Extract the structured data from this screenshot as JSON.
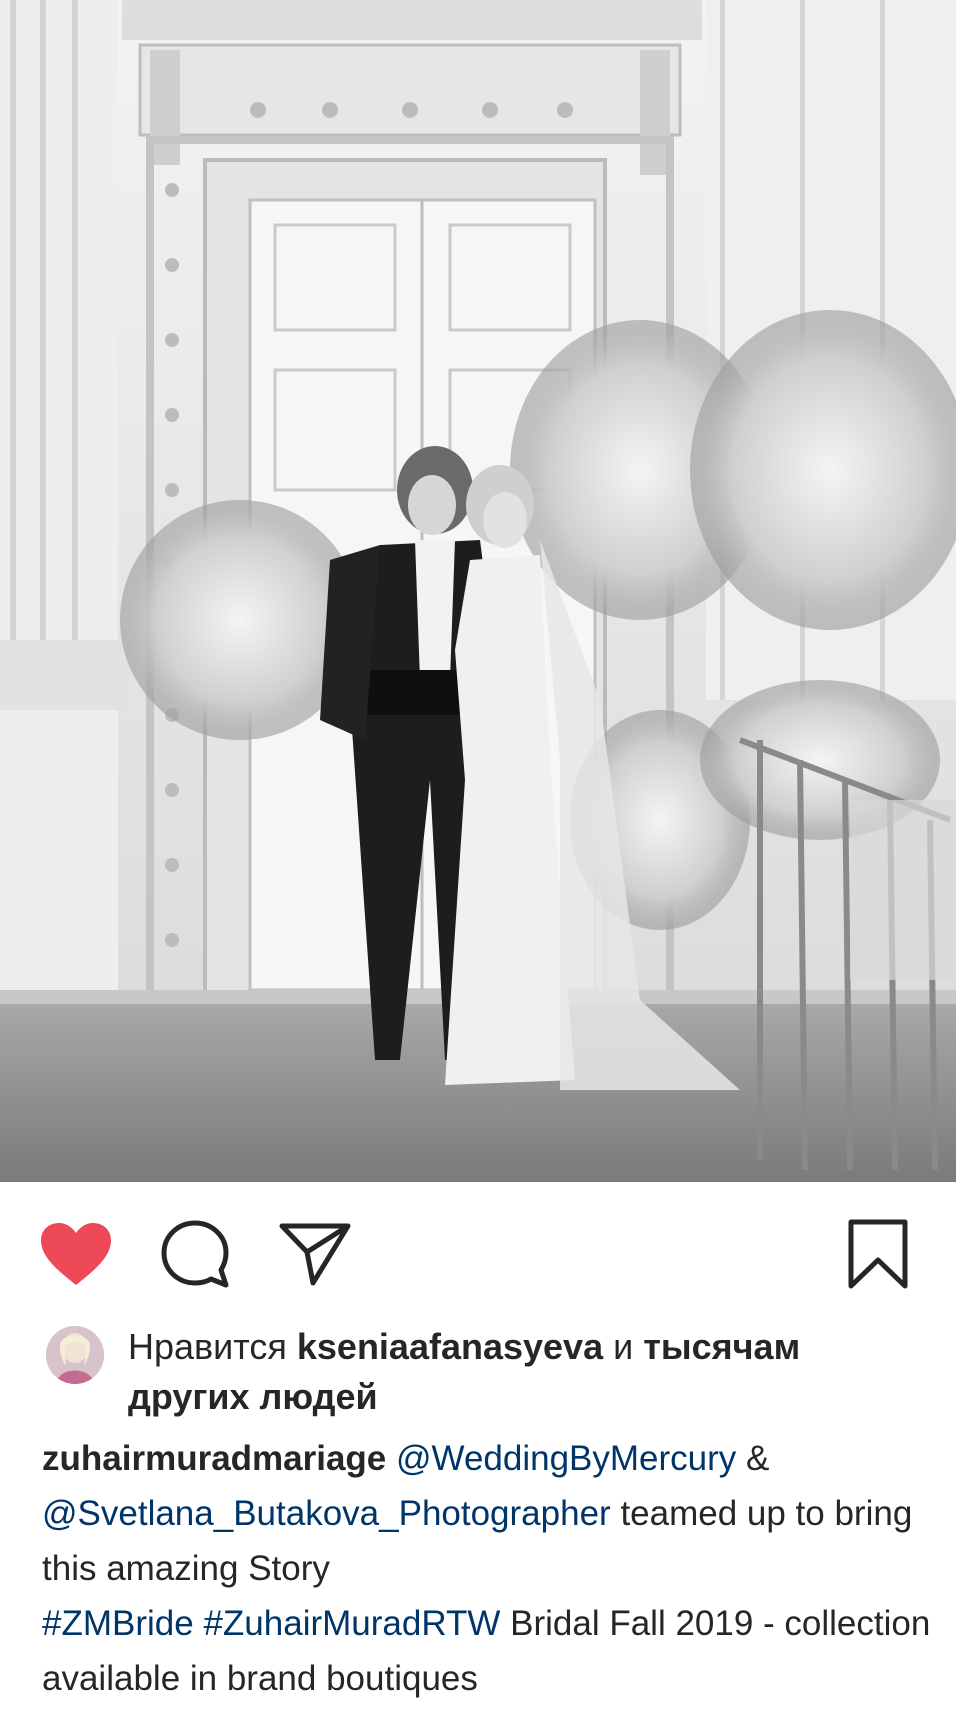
{
  "post": {
    "photo_alt": "black and white wedding photo",
    "liked": true
  },
  "actions": {
    "like_icon": "heart-filled-icon",
    "comment_icon": "comment-icon",
    "share_icon": "paper-plane-icon",
    "save_icon": "bookmark-icon",
    "like_color": "#ed4956"
  },
  "likes": {
    "prefix": "Нравится",
    "user": "kseniaafanasyeva",
    "and": "и",
    "others_line1": "тысячам",
    "others_line2": "других людей"
  },
  "caption": {
    "username": "zuhairmuradmariage",
    "mention1": "@WeddingByMercury",
    "amp": "&",
    "mention2": "@Svetlana_Butakova_Photographer",
    "text1": "teamed up to bring this amazing Story",
    "hashtag1": "#ZMBride",
    "hashtag2": "#ZuhairMuradRTW",
    "text2": "Bridal Fall 2019 - collection available in brand boutiques"
  },
  "colors": {
    "link": "#003569",
    "text": "#262626",
    "like": "#ed4956"
  }
}
